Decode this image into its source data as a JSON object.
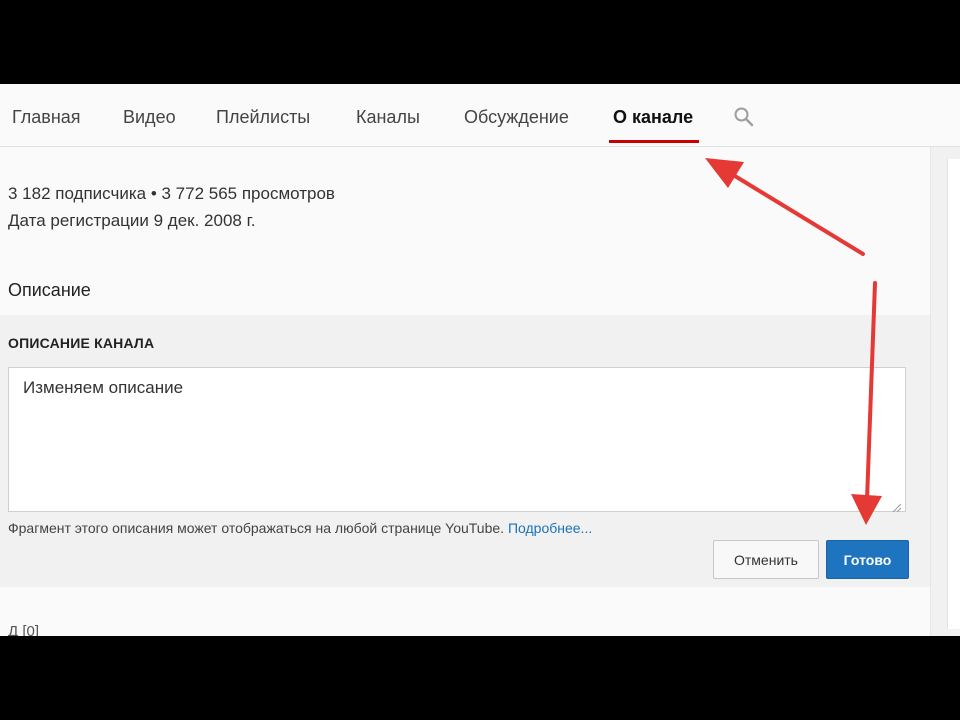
{
  "tabs": [
    {
      "label": "Главная"
    },
    {
      "label": "Видео"
    },
    {
      "label": "Плейлисты"
    },
    {
      "label": "Каналы"
    },
    {
      "label": "Обсуждение"
    },
    {
      "label": "О канале",
      "active": true
    }
  ],
  "stats": {
    "subscribers_views": "3 182 подписчика • 3 772 565 просмотров",
    "registered": "Дата регистрации 9 дек. 2008 г."
  },
  "description": {
    "title": "Описание",
    "edit_label": "ОПИСАНИЕ КАНАЛА",
    "value": "Изменяем описание",
    "hint": "Фрагмент этого описания может отображаться на любой странице YouTube.",
    "hint_link": "Подробнее...",
    "cancel_label": "Отменить",
    "done_label": "Готово"
  },
  "below_fragment": "Д                  [0]",
  "colors": {
    "accent_red": "#cc0000",
    "primary_blue": "#1f74c0",
    "annotation_arrow": "#e53935"
  },
  "icons": [
    "search-icon",
    "resize-handle-icon",
    "annotation-arrow-icon"
  ]
}
